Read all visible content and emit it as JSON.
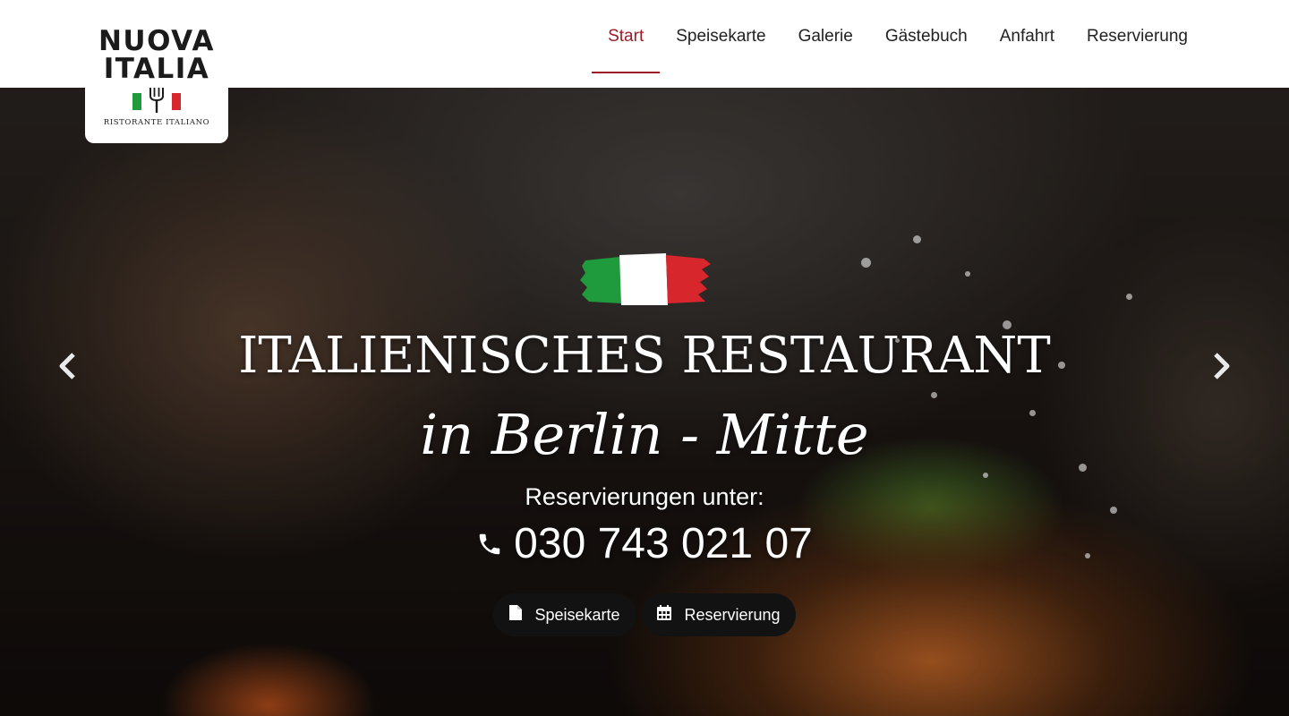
{
  "logo": {
    "line1": "NUOVA",
    "line2": "ITALIA",
    "subtitle": "RISTORANTE ITALIANO",
    "icon": "fork-icon"
  },
  "nav": {
    "items": [
      {
        "label": "Start",
        "active": true
      },
      {
        "label": "Speisekarte",
        "active": false
      },
      {
        "label": "Galerie",
        "active": false
      },
      {
        "label": "Gästebuch",
        "active": false
      },
      {
        "label": "Anfahrt",
        "active": false
      },
      {
        "label": "Reservierung",
        "active": false
      }
    ]
  },
  "hero": {
    "title": "ITALIENISCHES RESTAURANT",
    "script": "in Berlin - Mitte",
    "reserve_label": "Reservierungen unter:",
    "phone": "030 743 021 07",
    "phone_icon": "phone-icon",
    "buttons": {
      "menu": {
        "label": "Speisekarte",
        "icon": "document-icon"
      },
      "reservation": {
        "label": "Reservierung",
        "icon": "calendar-icon"
      }
    },
    "prev_icon": "chevron-left-icon",
    "next_icon": "chevron-right-icon"
  },
  "colors": {
    "accent": "#9c1c25",
    "flag_green": "#1f9a3d",
    "flag_white": "#ffffff",
    "flag_red": "#d7262c",
    "button_bg": "#121212"
  }
}
